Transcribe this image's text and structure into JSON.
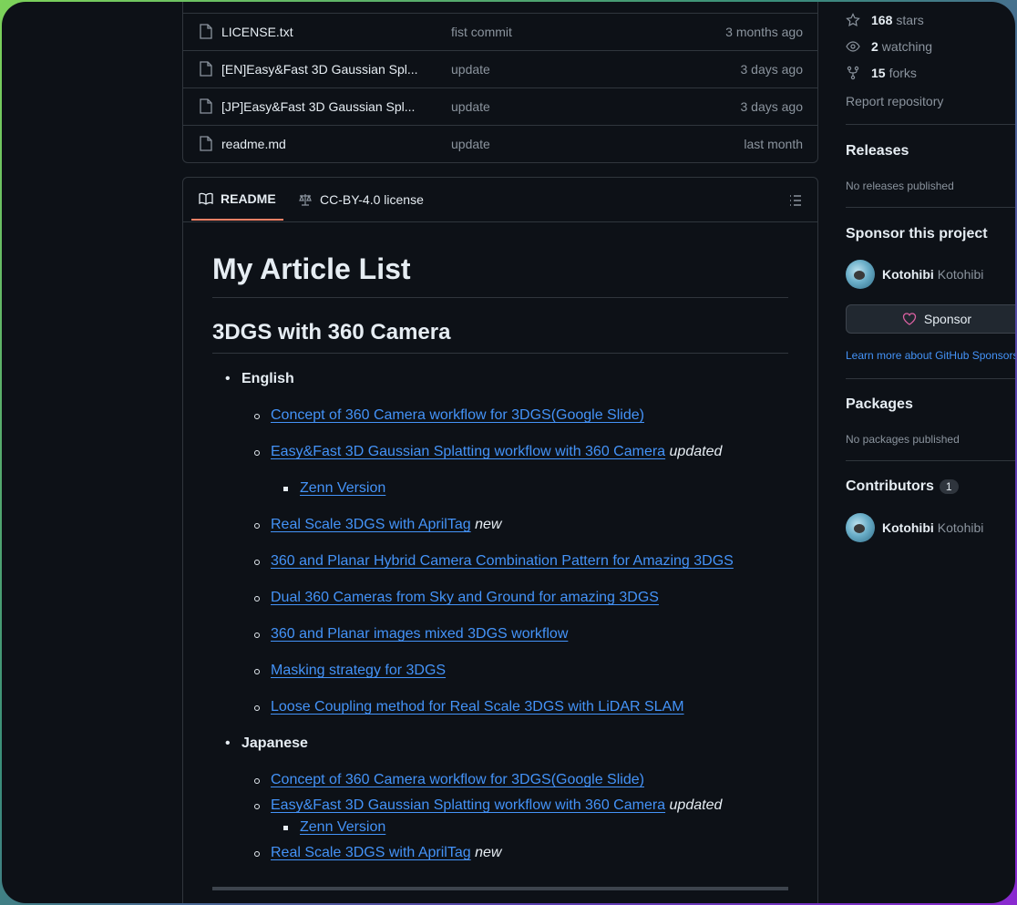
{
  "files": [
    {
      "name": "LICENSE.txt",
      "message": "fist commit",
      "date": "3 months ago"
    },
    {
      "name": "[EN]Easy&Fast 3D Gaussian Spl...",
      "message": "update",
      "date": "3 days ago"
    },
    {
      "name": "[JP]Easy&Fast 3D Gaussian Spl...",
      "message": "update",
      "date": "3 days ago"
    },
    {
      "name": "readme.md",
      "message": "update",
      "date": "last month"
    }
  ],
  "readme_tabs": {
    "readme": "README",
    "license": "CC-BY-4.0 license"
  },
  "readme": {
    "title": "My Article List",
    "section": "3DGS with 360 Camera",
    "english": "English",
    "japanese": "Japanese",
    "en_items": [
      "Concept of 360 Camera workflow for 3DGS(Google Slide)",
      "Easy&Fast 3D Gaussian Splatting workflow with 360 Camera",
      "Zenn Version",
      "Real Scale 3DGS with AprilTag",
      "360 and Planar Hybrid Camera Combination Pattern for Amazing 3DGS",
      "Dual 360 Cameras from Sky and Ground for amazing 3DGS",
      "360 and Planar images mixed 3DGS workflow",
      "Masking strategy for 3DGS",
      "Loose Coupling method for Real Scale 3DGS with LiDAR SLAM"
    ],
    "jp_items": [
      "Concept of 360 Camera workflow for 3DGS(Google Slide)",
      "Easy&Fast 3D Gaussian Splatting workflow with 360 Camera",
      "Zenn Version",
      "Real Scale 3DGS with AprilTag"
    ],
    "tag_updated": "updated",
    "tag_new": "new"
  },
  "sidebar": {
    "stars_count": "168",
    "stars_label": "stars",
    "watching_count": "2",
    "watching_label": "watching",
    "forks_count": "15",
    "forks_label": "forks",
    "report": "Report repository",
    "releases_title": "Releases",
    "releases_empty": "No releases published",
    "sponsor_title": "Sponsor this project",
    "sponsor_name": "Kotohibi",
    "sponsor_login": "Kotohibi",
    "sponsor_button": "Sponsor",
    "sponsor_learn": "Learn more about GitHub Sponsors",
    "packages_title": "Packages",
    "packages_empty": "No packages published",
    "contributors_title": "Contributors",
    "contributors_count": "1",
    "contributor_name": "Kotohibi",
    "contributor_login": "Kotohibi"
  },
  "colors": {
    "background": "#0d1117",
    "link": "#4493f8",
    "border": "#30363d",
    "tab_underline": "#f78166",
    "heart": "#db61a2"
  }
}
